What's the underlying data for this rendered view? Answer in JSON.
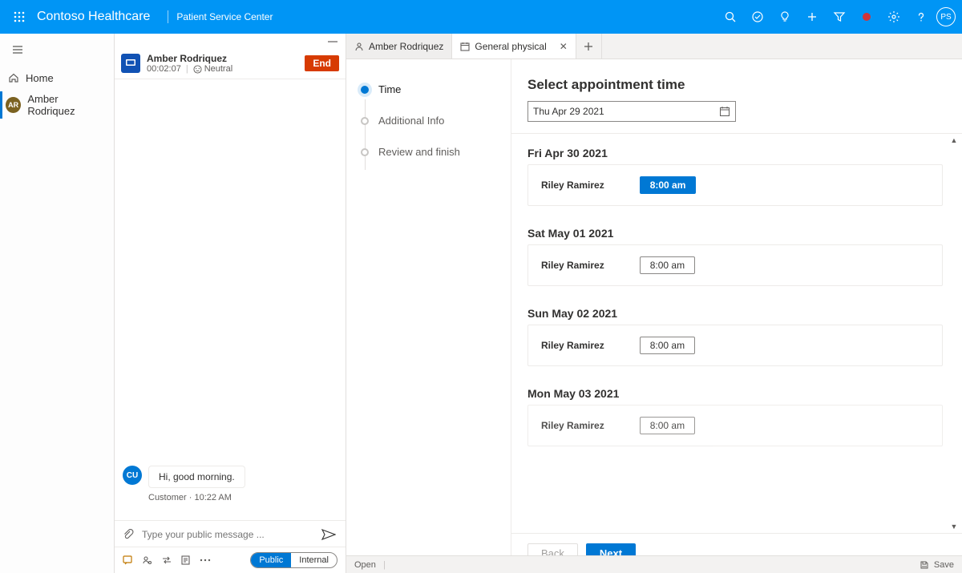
{
  "header": {
    "brand": "Contoso Healthcare",
    "subtitle": "Patient Service Center",
    "user_initials": "PS"
  },
  "leftnav": {
    "home": "Home",
    "patient": "Amber Rodriquez",
    "patient_initials": "AR"
  },
  "session": {
    "name": "Amber Rodriquez",
    "timer": "00:02:07",
    "sentiment": "Neutral",
    "end_label": "End"
  },
  "chat": {
    "avatar_initials": "CU",
    "message_text": "Hi, good morning.",
    "message_meta": "Customer · 10:22 AM",
    "compose_placeholder": "Type your public message ...",
    "pill_public": "Public",
    "pill_internal": "Internal"
  },
  "tabs": {
    "t1": "Amber Rodriquez",
    "t2": "General physical"
  },
  "steps": {
    "s1": "Time",
    "s2": "Additional Info",
    "s3": "Review and finish"
  },
  "appointment": {
    "heading": "Select appointment time",
    "date_value": "Thu Apr 29 2021",
    "days": [
      {
        "label": "Fri Apr 30 2021",
        "provider": "Riley Ramirez",
        "slot": "8:00 am",
        "selected": true
      },
      {
        "label": "Sat May 01 2021",
        "provider": "Riley Ramirez",
        "slot": "8:00 am",
        "selected": false
      },
      {
        "label": "Sun May 02 2021",
        "provider": "Riley Ramirez",
        "slot": "8:00 am",
        "selected": false
      },
      {
        "label": "Mon May 03 2021",
        "provider": "Riley Ramirez",
        "slot": "8:00 am",
        "selected": false
      }
    ],
    "back_label": "Back",
    "next_label": "Next"
  },
  "statusbar": {
    "state": "Open",
    "save": "Save"
  }
}
